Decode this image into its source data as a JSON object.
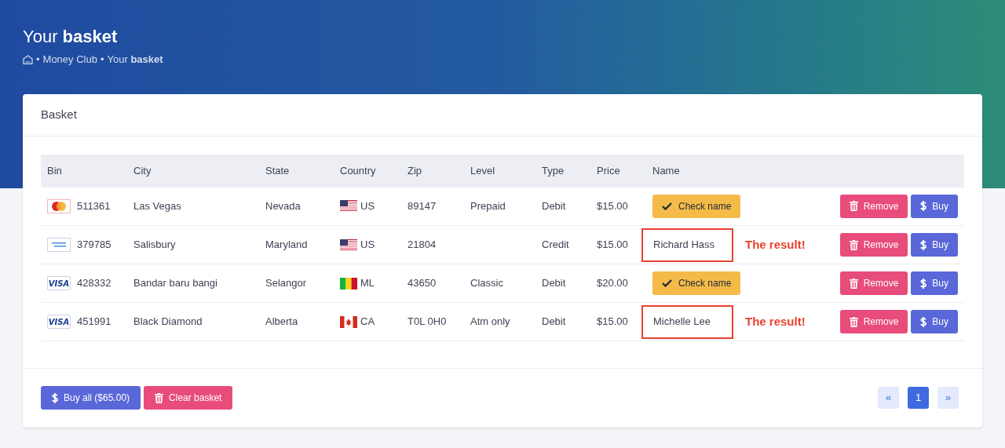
{
  "page_title": {
    "regular": "Your",
    "bold": "basket"
  },
  "breadcrumb": [
    {
      "separator": "•",
      "text": "Money Club"
    },
    {
      "separator": "•",
      "text": "Your **basket**"
    }
  ],
  "card": {
    "title": "Basket"
  },
  "table": {
    "columns": [
      "Bin",
      "City",
      "State",
      "Country",
      "Zip",
      "Level",
      "Type",
      "Price",
      "Name"
    ],
    "rows": [
      {
        "card_logo": {
          "kind": "mastercard"
        },
        "bin": "511361",
        "city": "Las Vegas",
        "state": "Nevada",
        "flag": {
          "kind": "us"
        },
        "country": "US",
        "zip": "89147",
        "level": "Prepaid",
        "type": "Debit",
        "price": "$15.00",
        "name": {
          "kind": "check",
          "label": "Check name"
        },
        "remove": "Remove",
        "buy": "Buy"
      },
      {
        "card_logo": {
          "kind": "amex"
        },
        "bin": "379785",
        "city": "Salisbury",
        "state": "Maryland",
        "flag": {
          "kind": "us"
        },
        "country": "US",
        "zip": "21804",
        "type": "Credit",
        "price": "$15.00",
        "name": {
          "kind": "result",
          "label": "Richard Hass",
          "note": "The result!"
        },
        "remove": "Remove",
        "buy": "Buy"
      },
      {
        "card_logo": {
          "kind": "visa",
          "label": "VISA"
        },
        "bin": "428332",
        "city": "Bandar baru bangi",
        "state": "Selangor",
        "flag": {
          "kind": "ml"
        },
        "country": "ML",
        "zip": "43650",
        "level": "Classic",
        "type": "Debit",
        "price": "$20.00",
        "name": {
          "kind": "check",
          "label": "Check name"
        },
        "remove": "Remove",
        "buy": "Buy"
      },
      {
        "card_logo": {
          "kind": "visa",
          "label": "VISA"
        },
        "bin": "451991",
        "city": "Black Diamond",
        "state": "Alberta",
        "flag": {
          "kind": "ca"
        },
        "country": "CA",
        "zip": "T0L 0H0",
        "level": "Atm only",
        "type": "Debit",
        "price": "$15.00",
        "name": {
          "kind": "result",
          "label": "Michelle Lee",
          "note": "The result!"
        },
        "remove": "Remove",
        "buy": "Buy"
      }
    ]
  },
  "footer": {
    "buy_all": "Buy all ($65.00)",
    "clear": "Clear basket"
  },
  "pagination": [
    {
      "label": "«",
      "selected": false
    },
    {
      "label": "1",
      "selected": true
    },
    {
      "label": "»",
      "selected": false
    }
  ]
}
